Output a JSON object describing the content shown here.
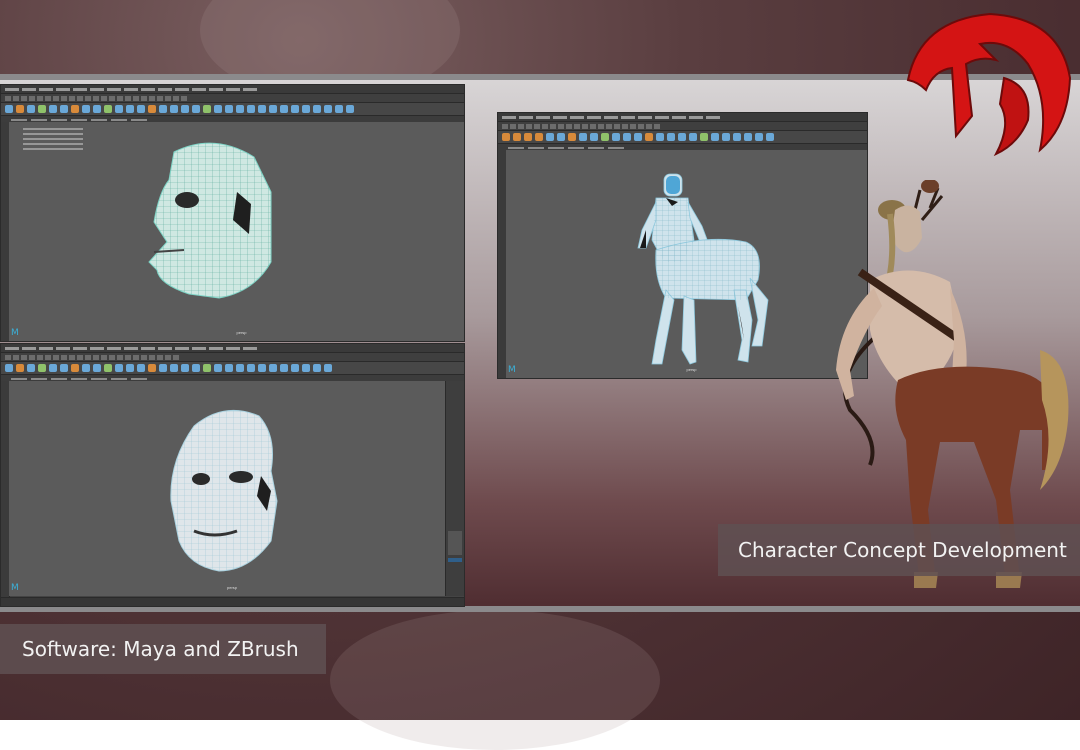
{
  "captions": {
    "concept": "Character Concept Development",
    "software": "Software:  Maya and ZBrush"
  },
  "viewport_label": "persp",
  "colors": {
    "background": "#4a2e31",
    "band_top": "#d9d6d7",
    "band_bottom": "#4e2c30",
    "maya_ui": "#444444",
    "viewport": "#5b5b5b",
    "wireframe": "#7fd6c8",
    "logo_red": "#d41414"
  },
  "windows": [
    {
      "name": "maya-window-face-side",
      "subject": "head-mesh-side-view"
    },
    {
      "name": "maya-window-face-front",
      "subject": "head-mesh-three-quarter-view"
    },
    {
      "name": "maya-window-centaur",
      "subject": "centaur-body-mesh"
    }
  ],
  "icons": [
    "brand-logo-icon",
    "maya-logo-icon",
    "centaur-render-image"
  ]
}
